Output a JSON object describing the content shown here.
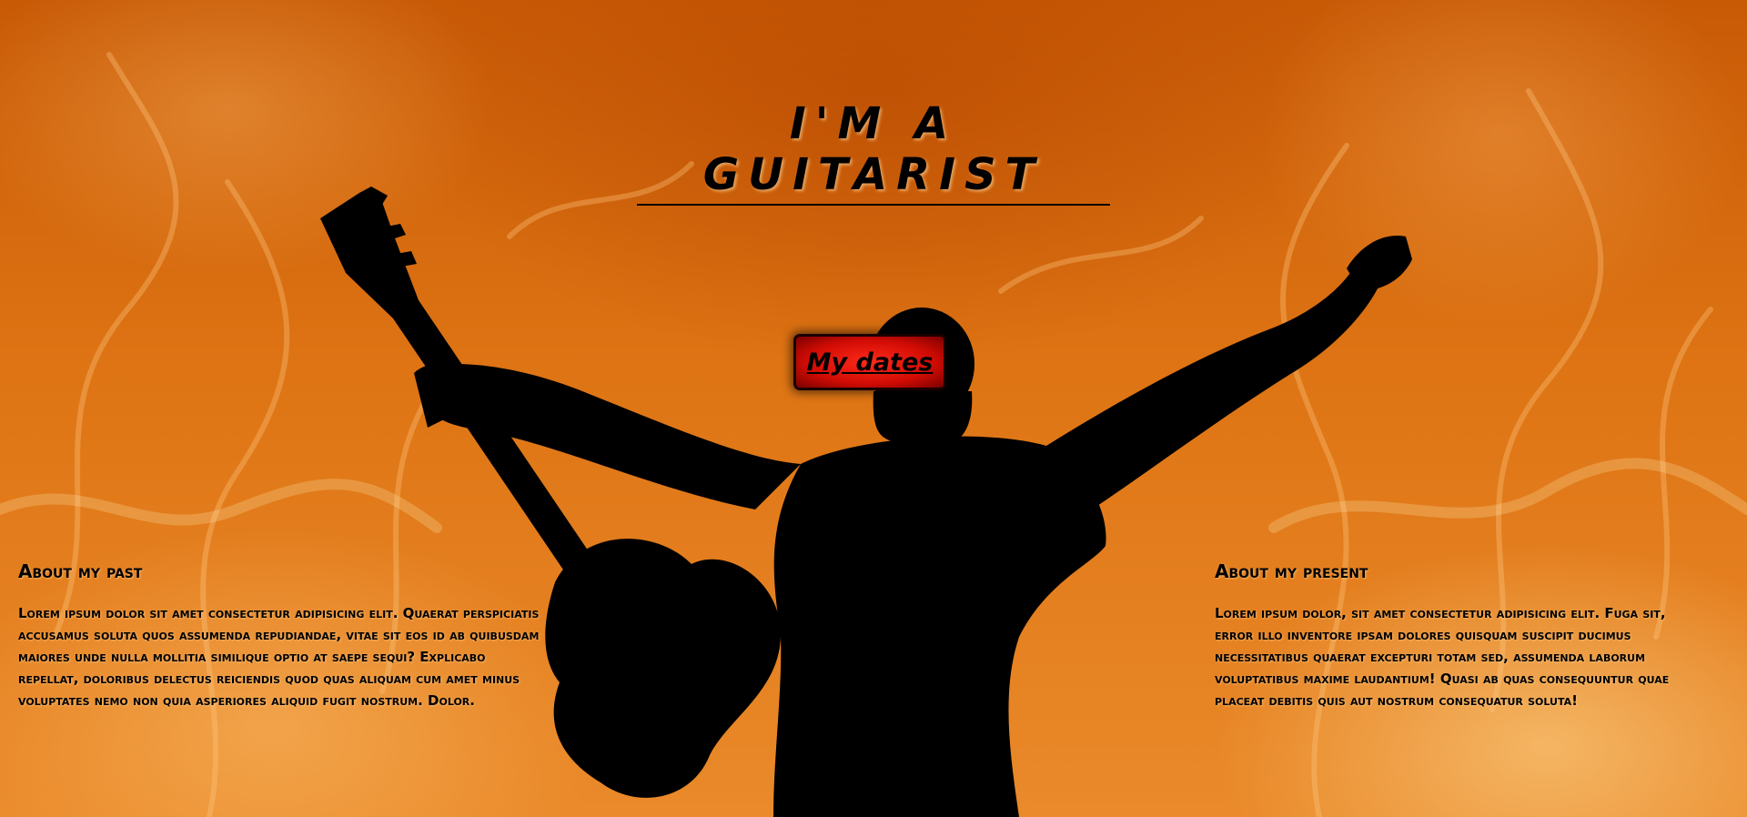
{
  "header": {
    "title": "I'M A GUITARIST"
  },
  "nav": {
    "dates_label": "My dates"
  },
  "sections": {
    "past": {
      "heading": "About my past",
      "body": "Lorem ipsum dolor sit amet consectetur adipisicing elit. Quaerat perspiciatis accusamus soluta quos assumenda repudiandae, vitae sit eos id ab quibusdam maiores unde nulla mollitia similique optio at saepe sequi? Explicabo repellat, doloribus delectus reiciendis quod quas aliquam cum amet minus voluptates nemo non quia asperiores aliquid fugit nostrum. Dolor."
    },
    "present": {
      "heading": "About my present",
      "body": "Lorem ipsum dolor, sit amet consectetur adipisicing elit. Fuga sit, error illo inventore ipsam dolores quisquam suscipit ducimus necessitatibus quaerat excepturi totam sed, assumenda laborum voluptatibus maxime laudantium! Quasi ab quas consequuntur quae placeat debitis quis aut nostrum consequatur soluta!"
    }
  },
  "background": {
    "image": "fire-background",
    "figure": "guitarist-silhouette"
  },
  "colors": {
    "fire_dark": "#c85a06",
    "fire_light": "#ea8a2a",
    "button_red": "#e0100a",
    "text": "#000000"
  }
}
